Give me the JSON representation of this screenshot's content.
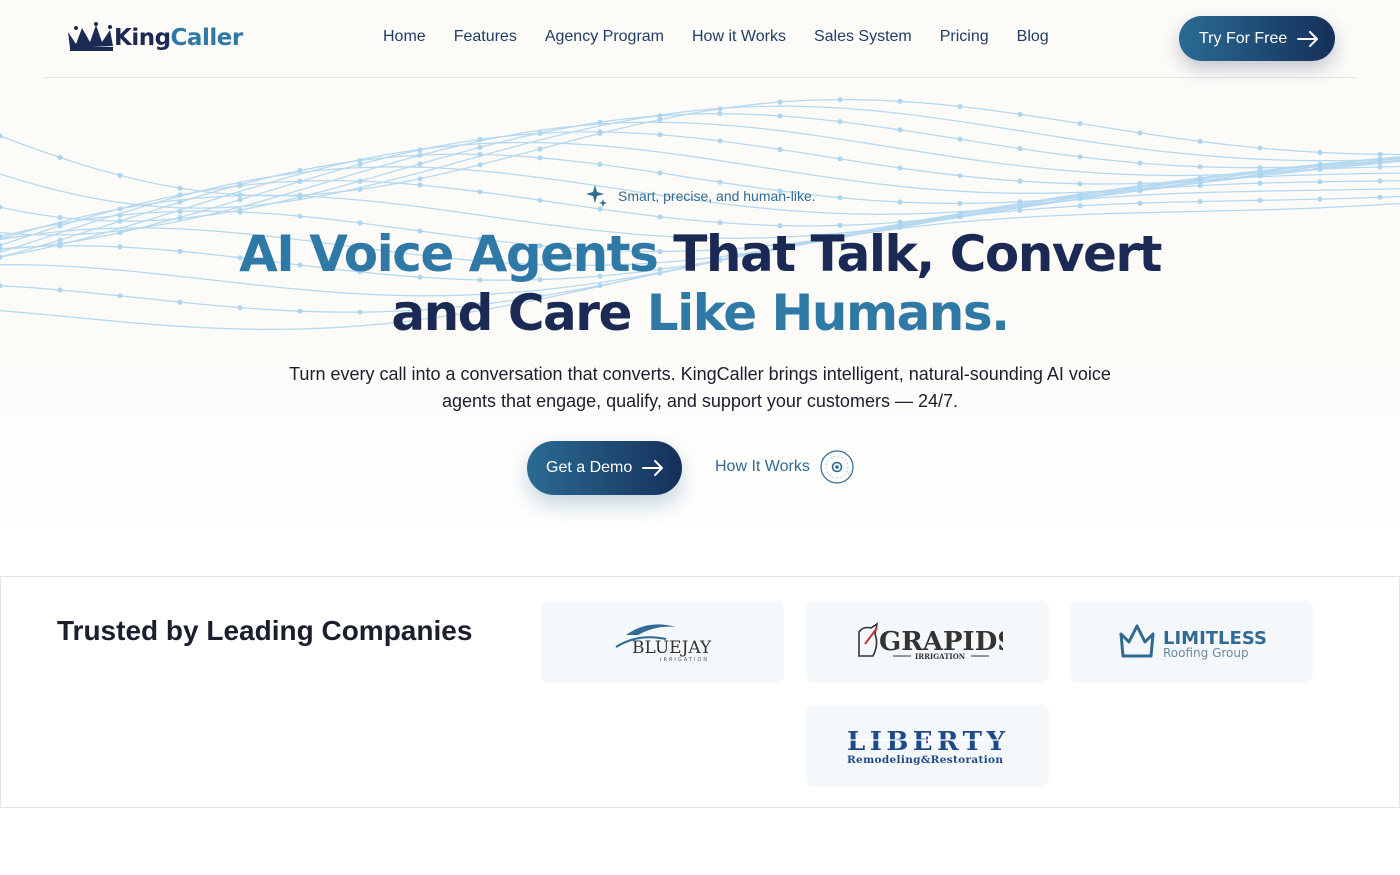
{
  "brand": {
    "name_part1": "King",
    "name_part2": "Caller"
  },
  "nav": {
    "items": [
      {
        "label": "Home"
      },
      {
        "label": "Features"
      },
      {
        "label": "Agency Program"
      },
      {
        "label": "How it Works"
      },
      {
        "label": "Sales System"
      },
      {
        "label": "Pricing"
      },
      {
        "label": "Blog"
      }
    ],
    "cta_label": "Try For Free"
  },
  "hero": {
    "tagline": "Smart, precise, and human-like.",
    "title_part1": "AI Voice Agents",
    "title_part2": "That Talk, Convert",
    "title_part3": "and Care",
    "title_part4": "Like Humans.",
    "subtitle": "Turn every call into a conversation that converts. KingCaller brings intelligent, natural-sounding AI voice agents that engage, qualify, and support your customers — 24/7.",
    "primary_button": "Get a Demo",
    "secondary_button": "How It Works"
  },
  "trusted": {
    "title": "Trusted by Leading Companies",
    "logos": [
      {
        "name": "BlueJay",
        "line1": "BLUEJAY",
        "line2": "IRRIGATION"
      },
      {
        "name": "GRapids",
        "line1": "GRAPIDS",
        "line2": "IRRIGATION"
      },
      {
        "name": "Limitless",
        "line1": "LIMITLESS",
        "line2": "Roofing Group"
      },
      {
        "name": "Liberty",
        "line1": "LIBERTY",
        "line2": "Remodeling&Restoration"
      }
    ]
  },
  "colors": {
    "brand_dark": "#1b2a55",
    "brand_blue": "#2f79a6",
    "button_gradient_start": "#2a6b93",
    "button_gradient_end": "#15305a"
  },
  "icons": {
    "logo": "crown-icon",
    "cta_arrow": "arrow-right-icon",
    "tagline": "sparkle-icon",
    "secondary_button": "play-circle-icon"
  }
}
